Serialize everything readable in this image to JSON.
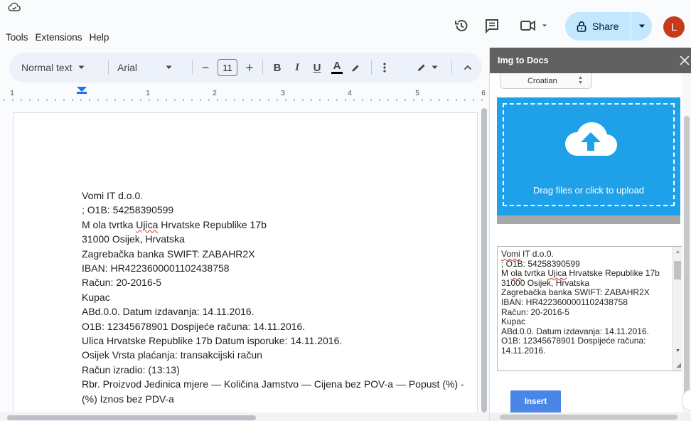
{
  "menu": [
    "Tools",
    "Extensions",
    "Help"
  ],
  "share": {
    "label": "Share"
  },
  "avatar": {
    "initial": "L",
    "color": "#c93a1a"
  },
  "toolbar": {
    "style": "Normal text",
    "font": "Arial",
    "font_size": "11",
    "minus": "−",
    "plus": "+",
    "bold": "B",
    "italic": "I",
    "underline": "U",
    "text_color": "A"
  },
  "ruler": {
    "labels": [
      "1",
      "1",
      "2",
      "3",
      "4",
      "5",
      "6"
    ]
  },
  "document": {
    "lines": [
      "Vomi IT d.o.0.",
      "; O1B: 54258390599",
      "31000 Osijek, Hrvatska",
      "Zagrebačka banka SWIFT: ZABAHR2X",
      "IBAN: HR4223600001102438758",
      "Račun: 20-2016-5",
      "Kupac",
      "ABd.0.0. Datum izdavanja: 14.11.2016.",
      "O1B: 12345678901 Dospijeće računa: 14.11.2016.",
      "Ulica Hrvatske Republike 17b Datum isporuke: 14.11.2016.",
      "Osijek Vrsta plaćanja: transakcijski račun",
      "Račun izradio: (13:13)",
      "Rbr. Proizvod Jedinica mjere — Količina  Jamstvo — Cijena bez POV-a — Popust (%) - (%) Iznos bez PDV-a"
    ],
    "line3_prefix": "M ola tvrtka ",
    "line3_spell": "Ujica",
    "line3_suffix": " Hrvatske Republike 17b"
  },
  "panel": {
    "title": "Img to Docs",
    "language": "Croatian",
    "drop_label": "Drag files or click to upload",
    "result": {
      "line1_spell": "Vomi",
      "line1_rest": " IT d.o.0.",
      "line2": "; O1B: 54258390599",
      "line3_a": "M ",
      "line3_spell1": "ola",
      "line3_b": " tvrtka ",
      "line3_spell2": "Ujica",
      "line3_c": " Hrvatske Republike 17b",
      "lines": [
        "31000 Osijek, Hrvatska",
        "Zagrebačka banka SWIFT: ZABAHR2X",
        "IBAN: HR4223600001102438758",
        "Račun: 20-2016-5",
        "Kupac",
        "ABd.0.0. Datum izdavanja: 14.11.2016.",
        "O1B: 12345678901 Dospijeće računa: 14.11.2016."
      ]
    },
    "insert_label": "Insert"
  },
  "colors": {
    "accent_share": "#c2e7ff",
    "dropzone": "#1ea1e8",
    "insert": "#4a86e8"
  }
}
